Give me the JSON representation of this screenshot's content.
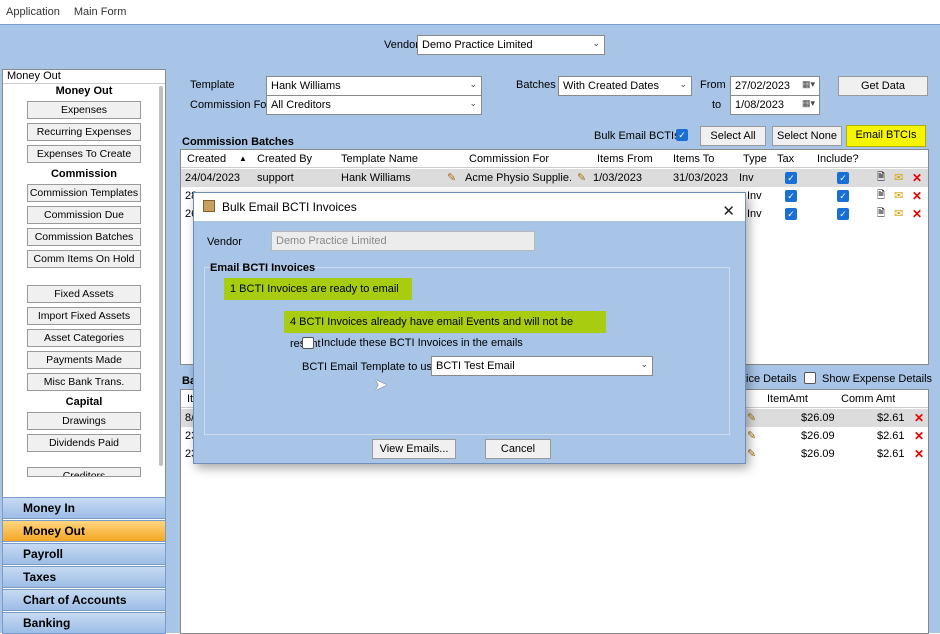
{
  "menu": [
    "Application",
    "Main Form"
  ],
  "vendor": {
    "label": "Vendor",
    "value": "Demo Practice Limited"
  },
  "sidebar": {
    "title": "Money Out",
    "groups": [
      {
        "head": "Money Out",
        "items": [
          "Expenses",
          "Recurring Expenses",
          "Expenses To Create"
        ]
      },
      {
        "head": "Commission",
        "items": [
          "Commission Templates",
          "Commission Due",
          "Commission Batches",
          "Comm Items On Hold"
        ]
      },
      {
        "head": "",
        "items": [
          "Fixed Assets",
          "Import Fixed Assets",
          "Asset Categories",
          "Payments Made",
          "Misc Bank Trans."
        ]
      },
      {
        "head": "Capital",
        "items": [
          "Drawings",
          "Dividends Paid"
        ]
      },
      {
        "head": "",
        "items": [
          "Creditors"
        ]
      }
    ],
    "nav": [
      "Money In",
      "Money Out",
      "Payroll",
      "Taxes",
      "Chart of Accounts",
      "Banking"
    ]
  },
  "filters": {
    "template_label": "Template",
    "template_value": "Hank Williams",
    "commission_label": "Commission For",
    "commission_value": "All Creditors",
    "batches_label": "Batches",
    "batches_value": "With Created Dates",
    "from_label": "From",
    "from_value": "27/02/2023",
    "to_label": "to",
    "to_value": "1/08/2023",
    "get_data": "Get Data"
  },
  "batches": {
    "title": "Commission Batches",
    "bulk_email_label": "Bulk Email BCTIs",
    "select_all": "Select All",
    "select_none": "Select None",
    "email_btcis": "Email BTCIs",
    "columns": [
      "Created",
      "Created By",
      "Template Name",
      "Commission For",
      "Items From",
      "Items To",
      "Type",
      "Tax",
      "Include?"
    ],
    "rows": [
      {
        "created": "24/04/2023",
        "by": "support",
        "template": "Hank Williams",
        "for": "Acme Physio Supplie...",
        "from": "1/03/2023",
        "to": "31/03/2023",
        "type": "Inv"
      },
      {
        "created": "28",
        "by": "",
        "template": "",
        "for": "",
        "from": "",
        "to": "",
        "type": "Inv"
      },
      {
        "created": "26",
        "by": "",
        "template": "",
        "for": "",
        "from": "",
        "to": "",
        "type": "Inv"
      }
    ]
  },
  "lower": {
    "title_fragment": "Ba",
    "col_fragment": "It",
    "invoice_details": "ice Details",
    "show_expense": "Show Expense Details",
    "columns": [
      "ItemAmt",
      "Comm Amt"
    ],
    "rows": [
      {
        "id": "8/",
        "amt": "$26.09",
        "comm": "$2.61"
      },
      {
        "id": "23",
        "amt": "$26.09",
        "comm": "$2.61"
      },
      {
        "id": "23",
        "amt": "$26.09",
        "comm": "$2.61"
      }
    ]
  },
  "dialog": {
    "title": "Bulk Email BCTI Invoices",
    "vendor_label": "Vendor",
    "vendor_value": "Demo Practice Limited",
    "group_title": "Email BCTI Invoices",
    "ready_msg": "1  BCTI Invoices are ready to email",
    "already_msg": "4  BCTI Invoices already have email Events and will not be resent",
    "include_label": "Include these BCTI Invoices in the emails",
    "template_label": "BCTI Email Template to use",
    "template_value": "BCTI Test Email",
    "view_emails": "View Emails...",
    "cancel": "Cancel"
  },
  "colors": {
    "background": "#a8c4e6",
    "highlight": "#f5f500",
    "green_highlight": "#a8cc10",
    "active_nav": "#f5a623",
    "checkbox": "#1a6fd4"
  }
}
